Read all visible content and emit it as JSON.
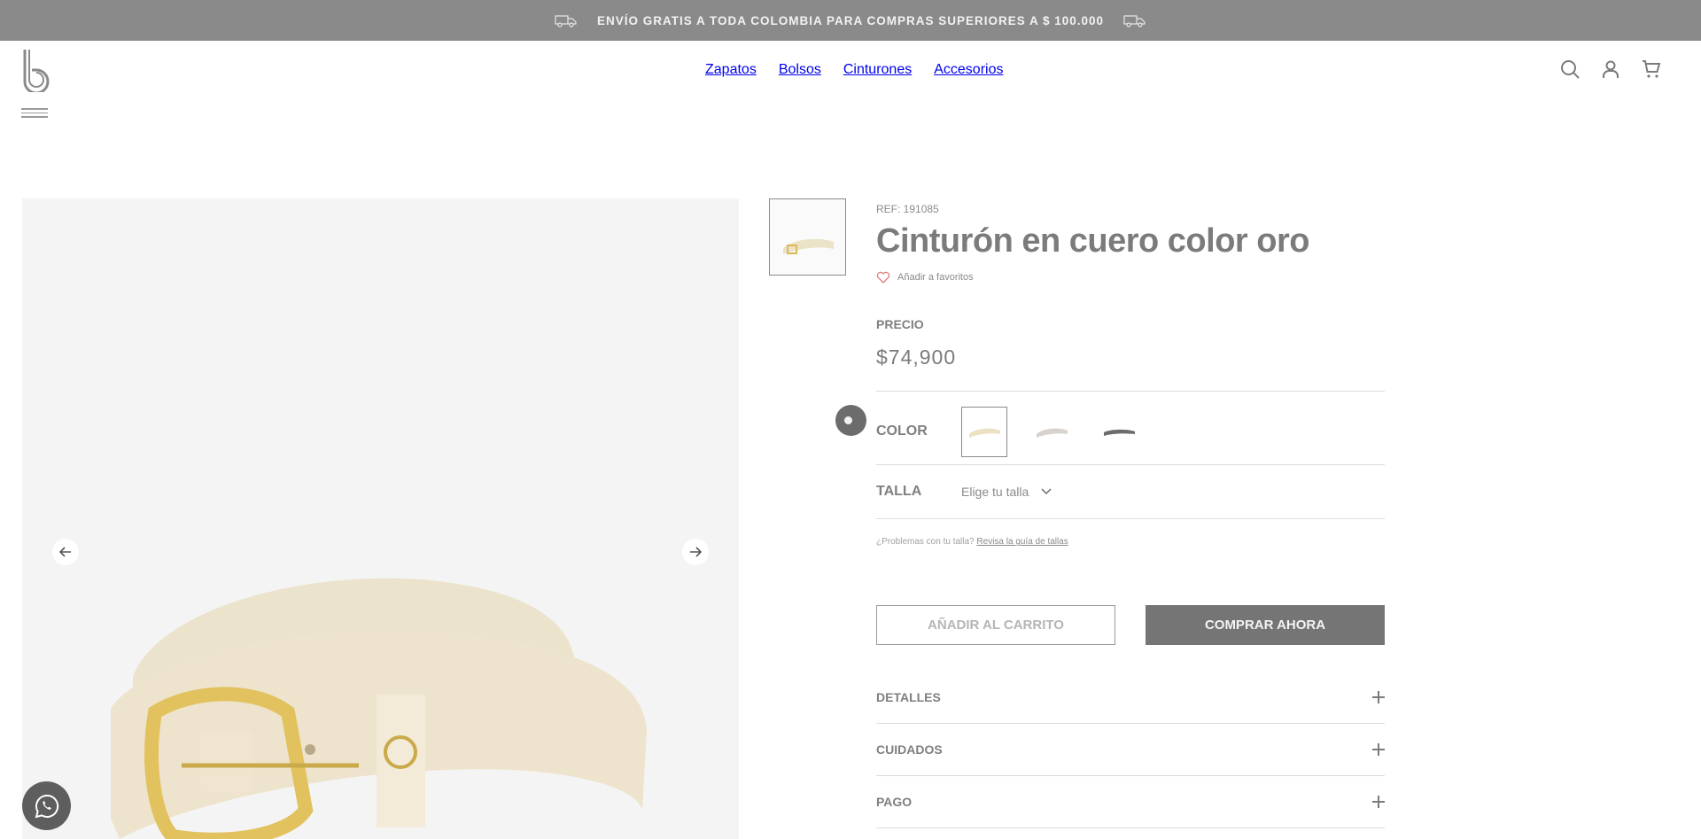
{
  "announcement": {
    "text": "ENVÍO GRATIS A TODA COLOMBIA PARA COMPRAS SUPERIORES A $ 100.000"
  },
  "nav": {
    "items": [
      "Zapatos",
      "Bolsos",
      "Cinturones",
      "Accesorios"
    ]
  },
  "header_icons": [
    "search-icon",
    "user-icon",
    "cart-icon"
  ],
  "product": {
    "ref": "REF: 191085",
    "title": "Cinturón en cuero color oro",
    "favorite_label": "Añadir a favoritos",
    "price_label": "PRECIO",
    "price": "$74,900",
    "color_label": "COLOR",
    "size_label": "TALLA",
    "size_placeholder": "Elige tu talla",
    "size_help_text": "¿Problemas con tu talla?",
    "size_help_link": "Revisa la guía de tallas",
    "add_to_cart": "AÑADIR AL CARRITO",
    "buy_now": "COMPRAR AHORA",
    "accordion": [
      "DETALLES",
      "CUIDADOS",
      "PAGO"
    ]
  },
  "colors": {
    "brand_gray": "#8a8a8a",
    "gallery_bg": "#f4f4f4",
    "belt_gold": "#eee3c8",
    "buckle_gold": "#e5c96b"
  }
}
